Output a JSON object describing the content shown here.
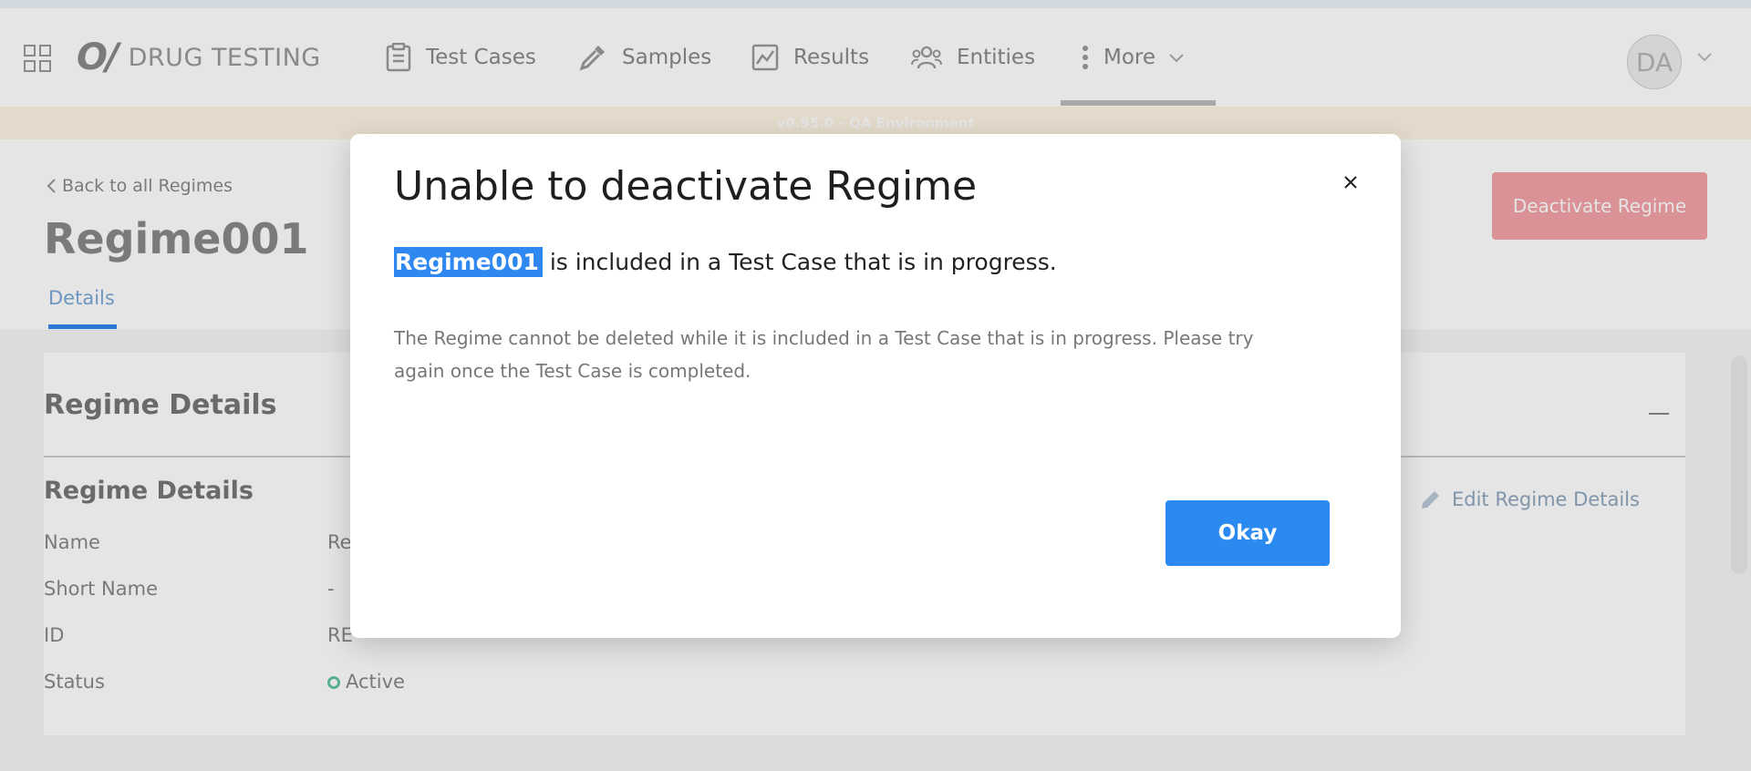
{
  "app": {
    "brand_name": "DRUG TESTING"
  },
  "nav": {
    "items": [
      {
        "label": "Test Cases",
        "icon": "clipboard-icon"
      },
      {
        "label": "Samples",
        "icon": "dropper-icon"
      },
      {
        "label": "Results",
        "icon": "chart-icon"
      },
      {
        "label": "Entities",
        "icon": "people-icon"
      },
      {
        "label": "More",
        "icon": "kebab-icon"
      }
    ],
    "avatar_initials": "DA"
  },
  "environment_banner": "v0.95.0 - QA Environment",
  "page": {
    "back_link": "Back to all Regimes",
    "title": "Regime001",
    "tab": "Details",
    "deactivate_label": "Deactivate Regime"
  },
  "details": {
    "section_title": "Regime Details",
    "subsection_title": "Regime Details",
    "edit_label": "Edit Regime Details",
    "fields": [
      {
        "label": "Name",
        "value": "Re"
      },
      {
        "label": "Short Name",
        "value": "-"
      },
      {
        "label": "ID",
        "value": "RE"
      },
      {
        "label": "Status",
        "value": "Active"
      }
    ]
  },
  "modal": {
    "title": "Unable to deactivate Regime",
    "highlighted_name": "Regime001",
    "message_rest": " is included in a Test Case that is in progress.",
    "description": "The Regime cannot be deleted while it is included in a Test Case that is in progress. Please try again once the Test Case is completed.",
    "okay_label": "Okay"
  },
  "colors": {
    "primary": "#2b8af0",
    "danger_faded": "#f3a3a8",
    "status_active": "#61c4a0"
  }
}
